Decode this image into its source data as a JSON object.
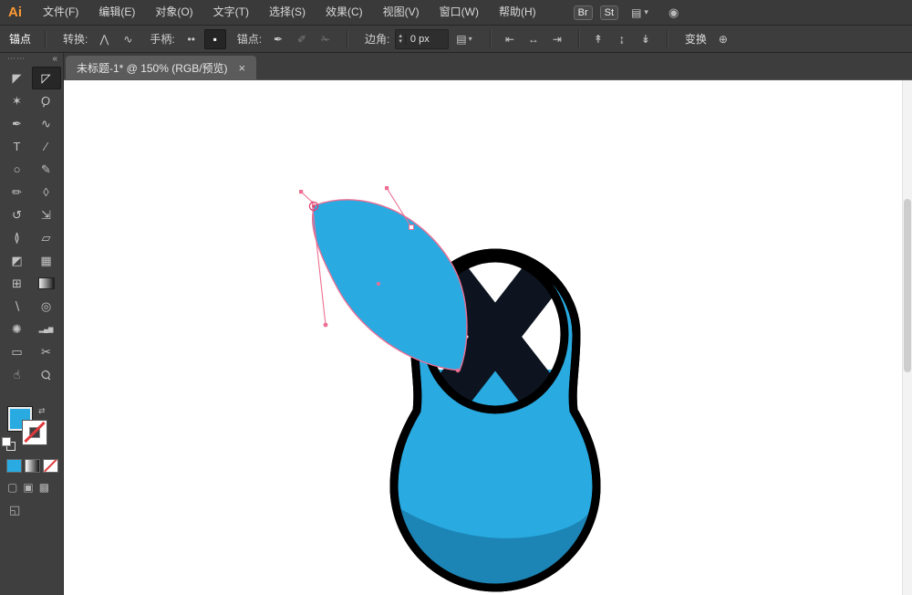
{
  "window": {
    "logo": "Ai"
  },
  "menu": {
    "items": [
      "文件(F)",
      "编辑(E)",
      "对象(O)",
      "文字(T)",
      "选择(S)",
      "效果(C)",
      "视图(V)",
      "窗口(W)",
      "帮助(H)"
    ],
    "br": "Br",
    "st": "St",
    "workspace_icon": "▤",
    "caret": "▾",
    "performance_icon": "◉"
  },
  "control": {
    "mode_label": "锚点",
    "convert_label": "转换:",
    "convert_corner_icon": "⋀",
    "convert_smooth_icon": "∿",
    "handle_label": "手柄:",
    "handle_show_icon": "••",
    "handle_hide_icon": "▪",
    "anchor_label": "锚点:",
    "anchor_add_icon": "✒",
    "anchor_remove_icon": "✐",
    "anchor_cut_icon": "✁",
    "corner_label": "边角:",
    "corner_value": "0 px",
    "spin_up": "▴",
    "spin_down": "▾",
    "dropdown_icon": "▤",
    "align_a": [
      "⇤",
      "↔",
      "⇥"
    ],
    "align_b": [
      "↟",
      "↨",
      "↡"
    ],
    "transform_label": "变换",
    "widget_icon": "⊕"
  },
  "tab": {
    "title": "未标题-1* @ 150% (RGB/预览)",
    "close": "×"
  },
  "tools": [
    {
      "name": "selection",
      "glyph": "◤"
    },
    {
      "name": "direct-selection",
      "glyph": "◸"
    },
    {
      "name": "magic-wand",
      "glyph": "✶"
    },
    {
      "name": "lasso",
      "glyph": "Ϙ"
    },
    {
      "name": "pen",
      "glyph": "✒"
    },
    {
      "name": "curvature",
      "glyph": "∿"
    },
    {
      "name": "type",
      "glyph": "T"
    },
    {
      "name": "line-segment",
      "glyph": "∕"
    },
    {
      "name": "ellipse",
      "glyph": "○"
    },
    {
      "name": "paintbrush",
      "glyph": "✎"
    },
    {
      "name": "shaper",
      "glyph": "✏"
    },
    {
      "name": "eraser",
      "glyph": "◊"
    },
    {
      "name": "rotate",
      "glyph": "↺"
    },
    {
      "name": "scale",
      "glyph": "⇲"
    },
    {
      "name": "width",
      "glyph": "≬"
    },
    {
      "name": "free-transform",
      "glyph": "▱"
    },
    {
      "name": "shape-builder",
      "glyph": "◩"
    },
    {
      "name": "perspective-grid",
      "glyph": "▦"
    },
    {
      "name": "mesh",
      "glyph": "⊞"
    },
    {
      "name": "gradient",
      "glyph": ""
    },
    {
      "name": "eyedropper",
      "glyph": "∖"
    },
    {
      "name": "blend",
      "glyph": "◎"
    },
    {
      "name": "symbol-sprayer",
      "glyph": "✺"
    },
    {
      "name": "column-graph",
      "glyph": "▂▄▆"
    },
    {
      "name": "artboard",
      "glyph": "▭"
    },
    {
      "name": "slice",
      "glyph": "✂"
    },
    {
      "name": "hand",
      "glyph": "☝"
    },
    {
      "name": "zoom",
      "glyph": "Ϙ"
    }
  ],
  "panel": {
    "grip": "⋯⋯",
    "collapse": "«",
    "swap_icon": "⇄",
    "draw_modes": [
      "▢",
      "▣",
      "▩"
    ],
    "screen_mode_icon": "◱"
  },
  "colors": {
    "fill": "#29ABE2",
    "body": "#29ABE2",
    "shade": "#1C85B5",
    "outline": "#000000",
    "x_dark": "#0D1420",
    "selection": "#ED6E92",
    "selection_deep": "#E0436F"
  }
}
